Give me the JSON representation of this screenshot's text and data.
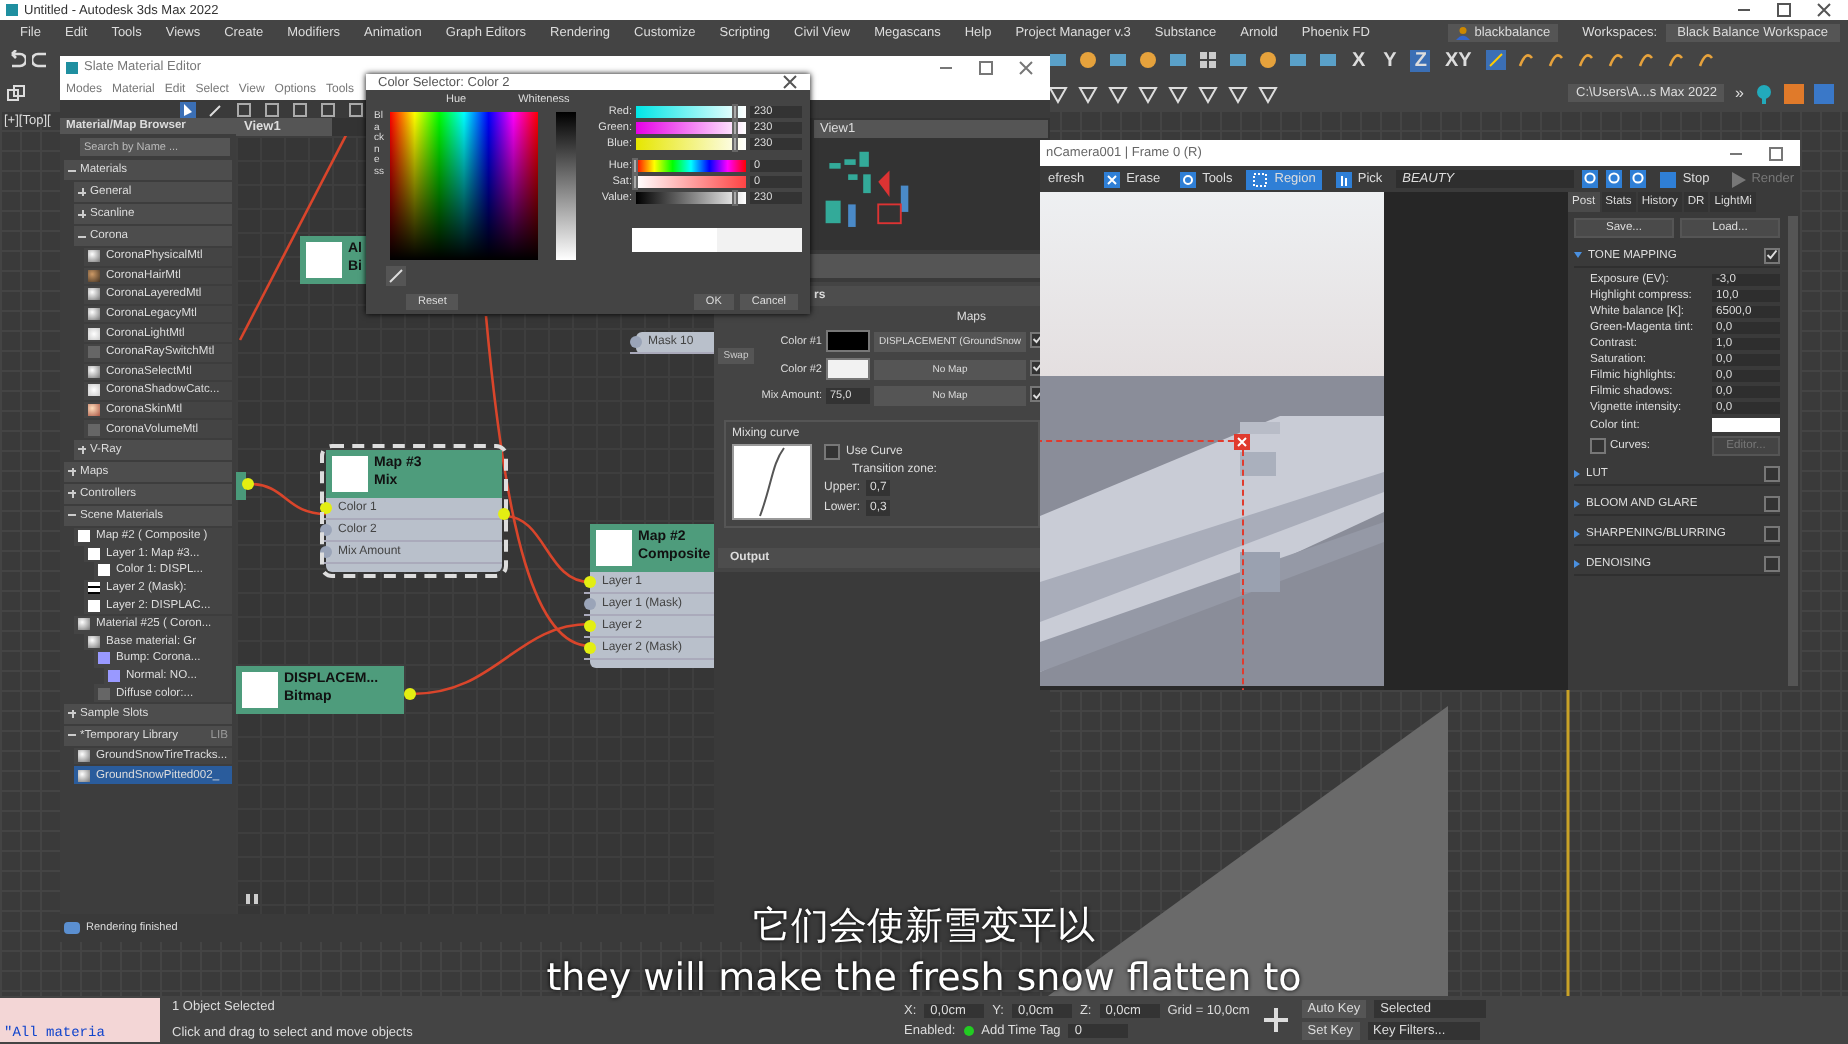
{
  "app": {
    "title": "Untitled - Autodesk 3ds Max 2022"
  },
  "menu": [
    "File",
    "Edit",
    "Tools",
    "Views",
    "Create",
    "Modifiers",
    "Animation",
    "Graph Editors",
    "Rendering",
    "Customize",
    "Scripting",
    "Civil View",
    "Megascans",
    "Help",
    "Project Manager v.3",
    "Substance",
    "Arnold",
    "Phoenix FD"
  ],
  "account": {
    "user": "blackbalance",
    "workspaces_label": "Workspaces:",
    "workspace": "Black Balance Workspace"
  },
  "toolbar": {
    "axes": [
      {
        "label": "X",
        "selected": false
      },
      {
        "label": "Y",
        "selected": false
      },
      {
        "label": "Z",
        "selected": true
      },
      {
        "label": "XY",
        "selected": false
      }
    ],
    "project_path": "C:\\Users\\A...s Max 2022",
    "more": "»"
  },
  "viewport": {
    "label": "[+][Top]["
  },
  "slate": {
    "title": "Slate Material Editor",
    "menu": [
      "Modes",
      "Material",
      "Edit",
      "Select",
      "View",
      "Options",
      "Tools"
    ],
    "browser": {
      "title": "Material/Map Browser",
      "search_placeholder": "Search by Name ...",
      "sections": [
        {
          "kind": "group",
          "label": "Materials",
          "expanded": true,
          "children": [
            {
              "kind": "group",
              "label": "General",
              "expanded": false
            },
            {
              "kind": "group",
              "label": "Scanline",
              "expanded": false
            },
            {
              "kind": "group",
              "label": "Corona",
              "expanded": true,
              "children": [
                {
                  "kind": "material",
                  "label": "CoronaPhysicalMtl"
                },
                {
                  "kind": "hair",
                  "label": "CoronaHairMtl"
                },
                {
                  "kind": "material",
                  "label": "CoronaLayeredMtl"
                },
                {
                  "kind": "material",
                  "label": "CoronaLegacyMtl"
                },
                {
                  "kind": "light",
                  "label": "CoronaLightMtl"
                },
                {
                  "kind": "gray",
                  "label": "CoronaRaySwitchMtl"
                },
                {
                  "kind": "material",
                  "label": "CoronaSelectMtl"
                },
                {
                  "kind": "light",
                  "label": "CoronaShadowCatc..."
                },
                {
                  "kind": "skin",
                  "label": "CoronaSkinMtl"
                },
                {
                  "kind": "gray",
                  "label": "CoronaVolumeMtl"
                }
              ]
            },
            {
              "kind": "group",
              "label": "V-Ray",
              "expanded": false
            }
          ]
        },
        {
          "kind": "group",
          "label": "Maps",
          "expanded": false
        },
        {
          "kind": "group",
          "label": "Controllers",
          "expanded": false
        },
        {
          "kind": "group",
          "label": "Scene Materials",
          "expanded": true,
          "children": [
            {
              "kind": "map",
              "label": "Map #2 ( Composite )",
              "children": [
                {
                  "kind": "map",
                  "label": "Layer 1: Map #3...",
                  "children": [
                    {
                      "kind": "map",
                      "label": "Color 1: DISPL..."
                    }
                  ]
                },
                {
                  "kind": "mask",
                  "label": "Layer 2 (Mask):"
                },
                {
                  "kind": "map",
                  "label": "Layer 2: DISPLAC..."
                }
              ]
            },
            {
              "kind": "material",
              "label": "Material #25 ( Coron...",
              "children": [
                {
                  "kind": "material",
                  "label": "Base material: Gr",
                  "children": [
                    {
                      "kind": "normal",
                      "label": "Bump: Corona...",
                      "children": [
                        {
                          "kind": "normal",
                          "label": "Normal: NO..."
                        }
                      ]
                    },
                    {
                      "kind": "gray",
                      "label": "Diffuse color:..."
                    }
                  ]
                }
              ]
            }
          ]
        },
        {
          "kind": "group",
          "label": "Sample Slots",
          "expanded": false
        },
        {
          "kind": "group",
          "label": "*Temporary Library",
          "expanded": true,
          "tag": "LIB",
          "children": [
            {
              "kind": "material",
              "label": "GroundSnowTireTracks...",
              "selected": false
            },
            {
              "kind": "material",
              "label": "GroundSnowPitted002_",
              "selected": true
            }
          ]
        }
      ]
    },
    "view_tab": "View1",
    "nodes": [
      {
        "title": "Al",
        "subtitle": "Bi",
        "selected": false
      },
      {
        "title": "Map #3",
        "subtitle": "Mix",
        "selected": true,
        "slots": [
          {
            "label": "Color 1",
            "connected": true
          },
          {
            "label": "Color 2",
            "connected": false
          },
          {
            "label": "Mix Amount",
            "connected": false
          }
        ]
      },
      {
        "title": "Map #2",
        "subtitle": "Composite",
        "selected": false,
        "slots": [
          {
            "label": "Layer 1",
            "connected": true
          },
          {
            "label": "Layer 1 (Mask)",
            "connected": false
          },
          {
            "label": "Layer 2",
            "connected": true
          },
          {
            "label": "Layer 2 (Mask)",
            "connected": true
          }
        ]
      },
      {
        "title": "DISPLACEM...",
        "subtitle": "Bitmap",
        "selected": false
      }
    ],
    "mask_slot": {
      "label": "Mask 10",
      "connected": false
    },
    "navigator": {
      "view": "View1"
    },
    "params": {
      "header": "rs",
      "maps_label": "Maps",
      "swap": "Swap",
      "rows": [
        {
          "kind": "swatch",
          "label": "Color #1",
          "color": "#000000",
          "map": "DISPLACEMENT (GroundSnow",
          "checked": true
        },
        {
          "kind": "swatch",
          "label": "Color #2",
          "color": "#f2f2f2",
          "map": "No Map",
          "checked": true
        },
        {
          "kind": "spinner",
          "label": "Mix Amount:",
          "value": "75,0",
          "map": "No Map",
          "checked": true
        }
      ],
      "curve": {
        "title": "Mixing curve",
        "use_curve": {
          "label": "Use Curve",
          "checked": false
        },
        "zone_title": "Transition zone:",
        "upper": {
          "label": "Upper:",
          "value": "0,7"
        },
        "lower": {
          "label": "Lower:",
          "value": "0,3"
        }
      },
      "output": "Output"
    },
    "status": "Rendering finished"
  },
  "color_selector": {
    "title": "Color Selector: Color 2",
    "hue_label": "Hue",
    "whiteness_label": "Whiteness",
    "blackness_label": "Blackness",
    "channels": [
      {
        "kind": "red",
        "label": "Red:",
        "value": "230",
        "level": 0.9
      },
      {
        "kind": "green",
        "label": "Green:",
        "value": "230",
        "level": 0.9
      },
      {
        "kind": "blue",
        "label": "Blue:",
        "value": "230",
        "level": 0.9
      },
      {
        "kind": "hue",
        "label": "Hue:",
        "value": "0",
        "level": 0
      },
      {
        "kind": "sat",
        "label": "Sat:",
        "value": "0",
        "level": 0
      },
      {
        "kind": "value",
        "label": "Value:",
        "value": "230",
        "level": 0.9
      }
    ],
    "reset": "Reset",
    "ok": "OK",
    "cancel": "Cancel"
  },
  "frame_buffer": {
    "title": "nCamera001 | Frame 0 (R)",
    "tools": [
      {
        "kind": "text",
        "label": "efresh",
        "selected": false
      },
      {
        "kind": "erase",
        "label": "Erase",
        "selected": false
      },
      {
        "kind": "tools",
        "label": "Tools",
        "selected": false
      },
      {
        "kind": "region",
        "label": "Region",
        "selected": true
      },
      {
        "kind": "pick",
        "label": "Pick",
        "selected": false
      }
    ],
    "channel": "BEAUTY",
    "stop": "Stop",
    "render": {
      "label": "Render",
      "disabled": true
    },
    "tabs": [
      {
        "label": "Post",
        "selected": true
      },
      {
        "label": "Stats",
        "selected": false
      },
      {
        "label": "History",
        "selected": false
      },
      {
        "label": "DR",
        "selected": false
      },
      {
        "label": "LightMi",
        "selected": false
      }
    ],
    "save": "Save...",
    "load": "Load...",
    "tone_mapping": {
      "title": "TONE MAPPING",
      "checked": true,
      "params": [
        {
          "label": "Exposure (EV):",
          "value": "-3,0"
        },
        {
          "label": "Highlight compress:",
          "value": "10,0"
        },
        {
          "label": "White balance [K]:",
          "value": "6500,0"
        },
        {
          "label": "Green-Magenta tint:",
          "value": "0,0"
        },
        {
          "label": "Contrast:",
          "value": "1,0"
        },
        {
          "label": "Saturation:",
          "value": "0,0"
        },
        {
          "label": "Filmic highlights:",
          "value": "0,0"
        },
        {
          "label": "Filmic shadows:",
          "value": "0,0"
        },
        {
          "label": "Vignette intensity:",
          "value": "0,0"
        }
      ],
      "color_tint": "Color tint:",
      "curves": {
        "label": "Curves:",
        "checked": false
      },
      "editor": {
        "label": "Editor...",
        "disabled": true
      }
    },
    "rollouts": [
      {
        "title": "LUT",
        "checked": false
      },
      {
        "title": "BLOOM AND GLARE",
        "checked": false
      },
      {
        "title": "SHARPENING/BLURRING",
        "checked": false
      },
      {
        "title": "DENOISING",
        "checked": false
      }
    ]
  },
  "status_bar": {
    "maxscript": "\"All materia",
    "selected_count": "1 Object Selected",
    "prompt": "Click and drag to select and move objects",
    "coords": [
      {
        "axis": "X:",
        "value": "0,0cm"
      },
      {
        "axis": "Y:",
        "value": "0,0cm"
      },
      {
        "axis": "Z:",
        "value": "0,0cm"
      }
    ],
    "grid": "Grid = 10,0cm",
    "enabled": "Enabled:",
    "time_tag": "Add Time Tag",
    "frame": "0",
    "auto_key": "Auto Key",
    "key_mode": "Selected",
    "set_key": "Set Key",
    "key_filters": "Key Filters..."
  },
  "subtitles": [
    "它们会使新雪变平以",
    "they will make the fresh snow flatten to"
  ]
}
